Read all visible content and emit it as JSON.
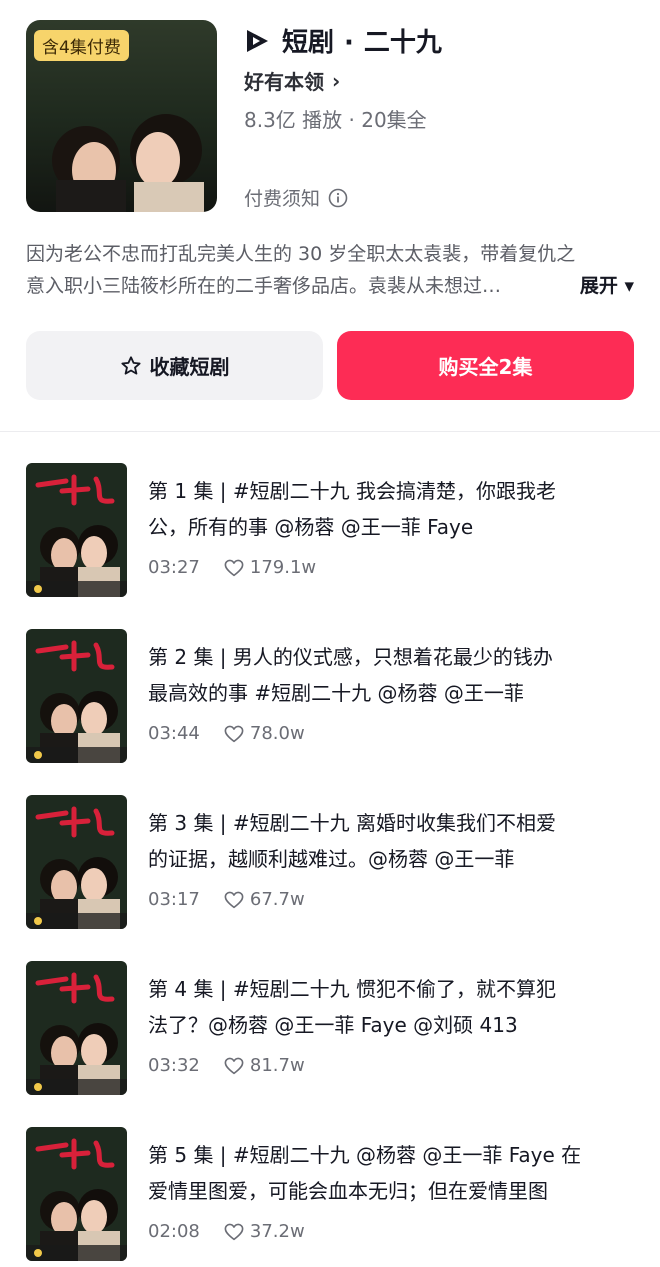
{
  "drama": {
    "badge": "含4集付费",
    "app_label": "短剧",
    "separator": "·",
    "name": "二十九",
    "author": "好有本领",
    "author_chevron": "›",
    "stats": "8.3亿 播放 · 20集全",
    "pay_notice": "付费须知",
    "description_line1": "因为老公不忠而打乱完美人生的 30 岁全职太太袁裴，带着复仇之",
    "description_line2": "意入职小三陆筱杉所在的二手奢侈品店。袁裴从未想过…",
    "expand_label": "展开 ▾",
    "poster_title_art": "二十九"
  },
  "actions": {
    "favorite_label": "收藏短剧",
    "buy_label": "购买全2集"
  },
  "episodes": [
    {
      "number": "1",
      "line1": "第 1 集 | #短剧二十九 我会搞清楚，你跟我老",
      "line2": "公，所有的事 @杨蓉 @王一菲 Faye",
      "duration": "03:27",
      "likes": "179.1w"
    },
    {
      "number": "2",
      "line1": "第 2 集 | 男人的仪式感，只想着花最少的钱办",
      "line2": "最高效的事 #短剧二十九 @杨蓉 @王一菲",
      "duration": "03:44",
      "likes": "78.0w"
    },
    {
      "number": "3",
      "line1": "第 3 集 | #短剧二十九 离婚时收集我们不相爱",
      "line2": "的证据，越顺利越难过。@杨蓉 @王一菲",
      "duration": "03:17",
      "likes": "67.7w"
    },
    {
      "number": "4",
      "line1": "第 4 集 | #短剧二十九 惯犯不偷了，就不算犯",
      "line2": "法了？@杨蓉 @王一菲 Faye @刘硕 413",
      "duration": "03:32",
      "likes": "81.7w"
    },
    {
      "number": "5",
      "line1": "第 5 集 | #短剧二十九 @杨蓉  @王一菲 Faye 在",
      "line2": "爱情里图爱，可能会血本无归；但在爱情里图",
      "duration": "02:08",
      "likes": "37.2w"
    }
  ],
  "colors": {
    "accent": "#fd2c55",
    "badge_bg": "#f7d46b",
    "secondary_button_bg": "#f2f2f4",
    "muted_text": "#6b6d75"
  },
  "icons": {
    "app_logo": "play-logo-icon",
    "author_chevron": "chevron-right-icon",
    "pay_notice": "info-icon",
    "favorite": "star-icon",
    "likes": "heart-icon"
  }
}
